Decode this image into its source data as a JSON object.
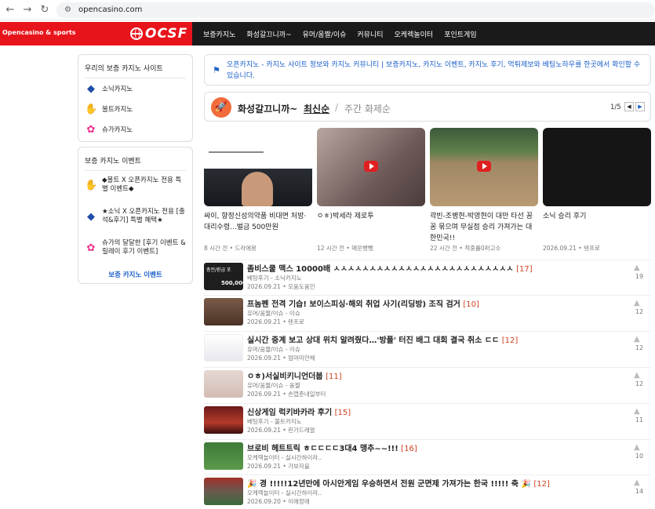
{
  "browser": {
    "url": "opencasino.com"
  },
  "header": {
    "brand": "Opencasino & sports",
    "logo": "OCSF",
    "nav": [
      "보증카지노",
      "화성갈끄니까~",
      "유머/움짤/이슈",
      "커뮤니티",
      "오케렉놀이터",
      "포인트게임"
    ]
  },
  "sidebar": {
    "casino_box": {
      "title": "우리의 보증 카지노 사이트",
      "items": [
        {
          "label": "소닉카지노",
          "icon": "sonic-icon"
        },
        {
          "label": "볼트카지노",
          "icon": "bolt-icon"
        },
        {
          "label": "슈가카지노",
          "icon": "sugar-icon"
        }
      ]
    },
    "event_box": {
      "title": "보증 카지노 이벤트",
      "items": [
        {
          "label": "◆볼트 X 오픈카지노 전용 특별 이벤트◆",
          "icon": "bolt-icon"
        },
        {
          "label": "★소닉 X 오픈카지노 전용 [출석&후기] 특별 혜택★",
          "icon": "sonic-icon"
        },
        {
          "label": "슈가의 달달한 [후기 이벤트 & 릴레이 후기 이벤트]",
          "icon": "sugar-icon"
        }
      ],
      "link": "보증 카지노 이벤트"
    }
  },
  "announcement": {
    "text": "오픈카지노 - 카지노 사이트 정보와 카지노 커뮤니티 | 보증카지노, 카지노 이벤트, 카지노 후기, 먹튀제보와 베팅노하우를 한곳에서 확인할 수 있습니다."
  },
  "board": {
    "title": "화성갈끄니까~",
    "sort_active": "최신순",
    "sort_sep": "/",
    "sort_other": "주간 화제순",
    "pager": "1/5",
    "cards": [
      {
        "title": "싸이, 향정신성의약품 비대면 처방· 대리수령...벌금 500만원",
        "meta": "8 시간 전 • 드라에몽"
      },
      {
        "title": "ㅇㅎ)박세라 제로투",
        "meta": "12 시간 전 • 매운뻥뼁"
      },
      {
        "title": "곽빈-조병현-박영현이 대만 타선 꽁꽁 묶으며 무실점 승리 가져가는 대한민국!!",
        "meta": "22 시간 전 • 적중률0퍼고수"
      },
      {
        "title": "소닉 승리 후기",
        "meta": "2026.09.21 • 텐프로"
      }
    ],
    "list": [
      {
        "title": "좀비스쿨 맥스 10000배 ㅅㅅㅅㅅㅅㅅㅅㅅㅅㅅㅅㅅㅅㅅㅅㅅㅅㅅㅅㅅㅅㅅㅅㅅㅅ",
        "count": "[17]",
        "category": "베팅후기 - 소닉카지노",
        "date": "2026.09.21 • 오움도움인",
        "votes": "19",
        "thumb_text": "충전/환급 포",
        "thumb_text2": "500,000"
      },
      {
        "title": "프놈펜 전격 기습! 보이스피싱·해외 취업 사기(리딩방) 조직 검거",
        "count": "[10]",
        "category": "유머/움짤/이슈 - 이슈",
        "date": "2026.09.21 • 텐프로",
        "votes": "12"
      },
      {
        "title": "실시간 중계 보고 상대 위치 알려줬다…'방플' 터진 배그 대회 결국 취소 ㄷㄷ",
        "count": "[12]",
        "category": "유머/움짤/이슈 - 이슈",
        "date": "2026.09.21 • 엄마미안해",
        "votes": "12"
      },
      {
        "title": "ㅇㅎ)서실비키니언더붑",
        "count": "[11]",
        "category": "유머/움짤/이슈 - 움짤",
        "date": "2026.09.21 • 손맵준내일부터",
        "votes": "12"
      },
      {
        "title": "신상게임 럭키바카라 후기",
        "count": "[15]",
        "category": "베팅후기 - 볼트카지노",
        "date": "2026.09.21 • 린가드레알",
        "votes": "11"
      },
      {
        "title": "브로비 헤트트릭 ㅎㄷㄷㄷㄷ3대4 맹추~~!!!",
        "count": "[16]",
        "category": "오케렉놀이터 - 실시간하이라..",
        "date": "2026.09.21 • 가보자을",
        "votes": "10"
      },
      {
        "title": "🎉 경 !!!!!12년만에 아시안게임 우승하면서 전원 군면제 가져가는 한국 !!!!! 축 🎉",
        "count": "[12]",
        "category": "오케렉놀이터 - 실시간하이라..",
        "date": "2026.09.20 • 이에정애",
        "votes": "14"
      }
    ]
  }
}
